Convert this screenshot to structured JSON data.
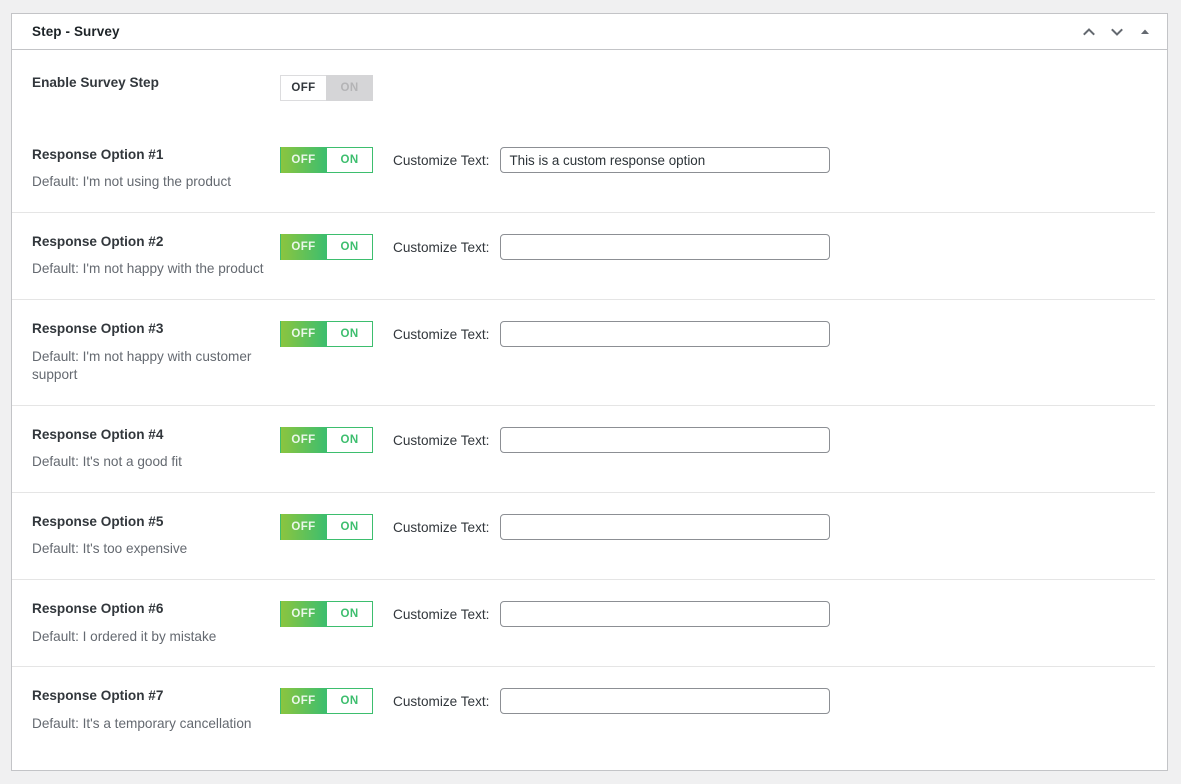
{
  "panel": {
    "title": "Step - Survey",
    "header_actions": [
      {
        "name": "move-up-icon",
        "label": "Move up"
      },
      {
        "name": "move-down-icon",
        "label": "Move down"
      },
      {
        "name": "collapse-icon",
        "label": "Collapse"
      }
    ]
  },
  "colors": {
    "page_background": "#f0f0f1",
    "panel_background": "#ffffff",
    "panel_border": "#c3c4c7",
    "divider": "#e5e5e5",
    "title_text": "#1d2327",
    "label_text": "#32373c",
    "muted_text": "#646970",
    "toggle_green_start": "#8bc53f",
    "toggle_green_end": "#3dbe6e",
    "toggle_on_text": "#3dbe6e",
    "toggle_disabled_bg": "#d5d5d7",
    "toggle_disabled_text": "#b4b4b6",
    "input_border": "#8c8f94"
  },
  "toggle_labels": {
    "off": "OFF",
    "on": "ON"
  },
  "enable_row": {
    "title": "Enable Survey Step",
    "toggle_state": "off",
    "toggle_enabled": false
  },
  "customize_label": "Customize Text:",
  "input_placeholder": "",
  "options": [
    {
      "title": "Response Option #1",
      "default_text": "Default: I'm not using the product",
      "toggle_state": "off",
      "customize_value": "This is a custom response option"
    },
    {
      "title": "Response Option #2",
      "default_text": "Default: I'm not happy with the product",
      "toggle_state": "off",
      "customize_value": ""
    },
    {
      "title": "Response Option #3",
      "default_text": "Default: I'm not happy with customer support",
      "toggle_state": "off",
      "customize_value": ""
    },
    {
      "title": "Response Option #4",
      "default_text": "Default: It's not a good fit",
      "toggle_state": "off",
      "customize_value": ""
    },
    {
      "title": "Response Option #5",
      "default_text": "Default: It's too expensive",
      "toggle_state": "off",
      "customize_value": ""
    },
    {
      "title": "Response Option #6",
      "default_text": "Default: I ordered it by mistake",
      "toggle_state": "off",
      "customize_value": ""
    },
    {
      "title": "Response Option #7",
      "default_text": "Default: It's a temporary cancellation",
      "toggle_state": "off",
      "customize_value": ""
    }
  ]
}
